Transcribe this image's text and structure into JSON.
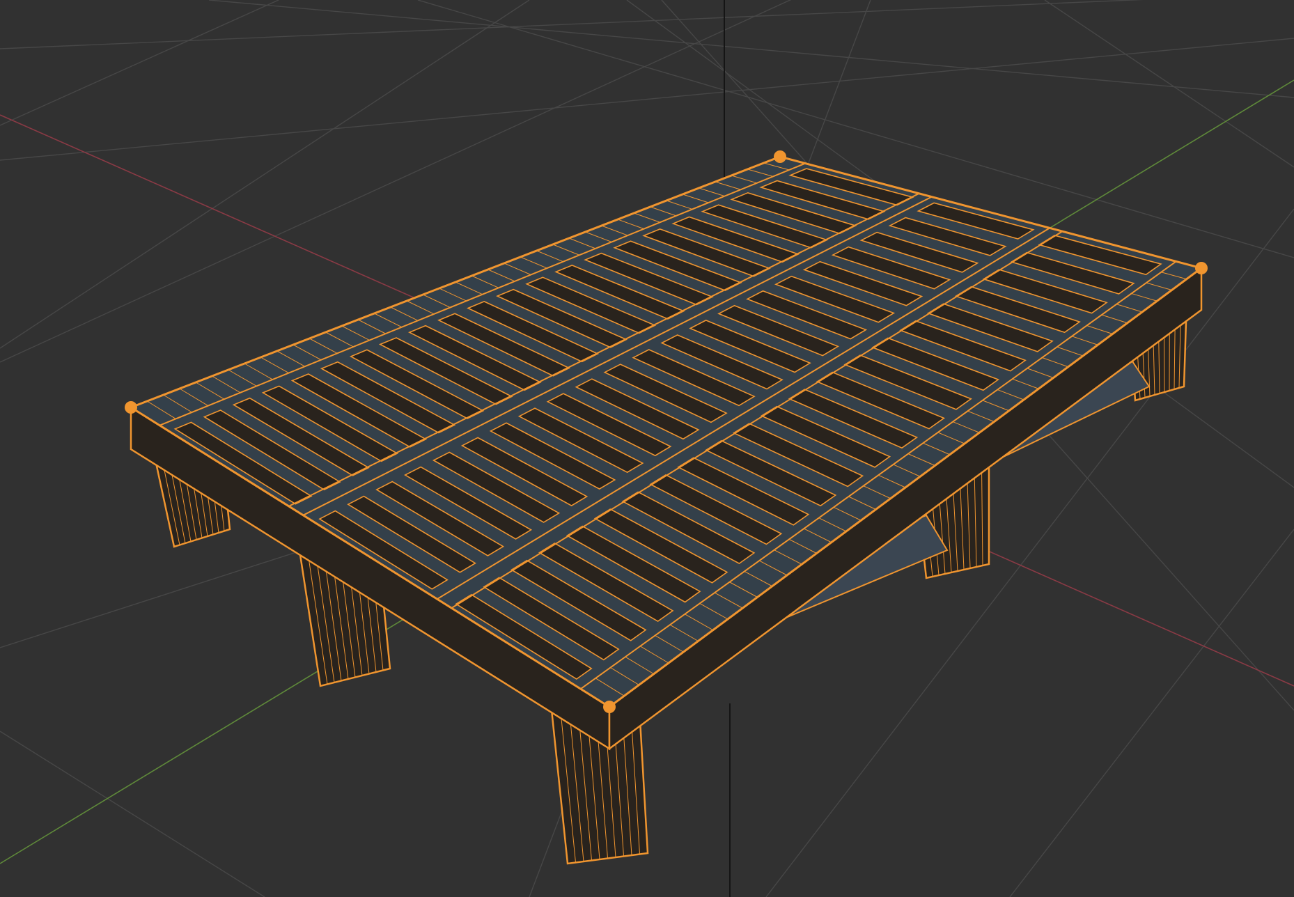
{
  "viewport": {
    "kind": "3d-viewport",
    "shading": "wireframe",
    "selected_object": "pallet-mesh"
  },
  "colors": {
    "background": "#313131",
    "grid": "#474747",
    "x_axis": "#8a3a45",
    "y_axis": "#5f8a3a",
    "z_axis": "#151515",
    "wire": "#f0952f",
    "wire_dim": "#c8741f",
    "face_top": "#34404a",
    "face_dark": "#29231d",
    "face_inner": "#3b4652"
  }
}
